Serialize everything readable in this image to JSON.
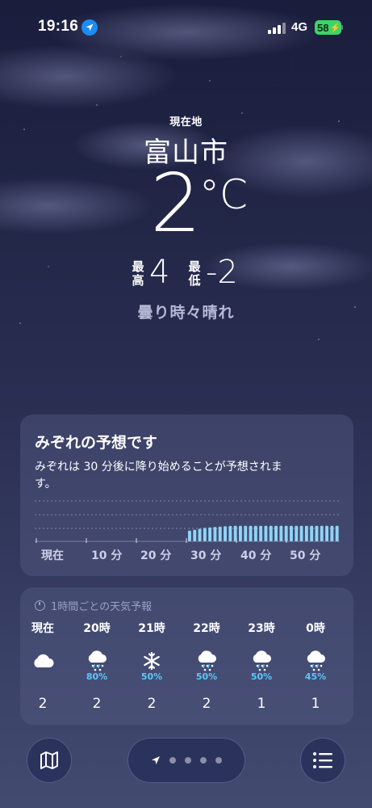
{
  "status_bar": {
    "time": "19:16",
    "network": "4G",
    "battery": "58"
  },
  "header": {
    "location_label": "現在地",
    "city": "富山市",
    "temperature": "2",
    "unit": "°C",
    "high_label": "最高",
    "high": "4",
    "low_label": "最低",
    "low": "-2",
    "condition": "曇り時々晴れ"
  },
  "precip_card": {
    "title": "みぞれの予想です",
    "description": "みぞれは 30 分後に降り始めることが予想されます。",
    "ticks": [
      "現在",
      "10 分",
      "20 分",
      "30 分",
      "40 分",
      "50 分"
    ],
    "intensity": [
      0,
      0,
      0,
      0,
      0,
      0,
      0,
      0,
      0,
      0,
      0,
      0,
      0,
      0,
      0,
      0,
      0,
      0,
      0,
      0,
      0,
      0,
      0,
      0,
      0,
      0,
      0,
      0,
      0,
      0,
      0.55,
      0.6,
      0.65,
      0.7,
      0.72,
      0.74,
      0.76,
      0.78,
      0.79,
      0.8,
      0.8,
      0.8,
      0.8,
      0.8,
      0.8,
      0.8,
      0.8,
      0.8,
      0.8,
      0.8,
      0.8,
      0.8,
      0.8,
      0.8,
      0.8,
      0.8,
      0.8,
      0.8,
      0.8,
      0.8
    ]
  },
  "hourly_card": {
    "header": "1時間ごとの天気予報",
    "hours": [
      {
        "label": "現在",
        "icon": "cloud-icon",
        "pct": "",
        "temp": "2"
      },
      {
        "label": "20時",
        "icon": "sleet-icon",
        "pct": "80%",
        "temp": "2"
      },
      {
        "label": "21時",
        "icon": "snowflake-icon",
        "pct": "50%",
        "temp": "2"
      },
      {
        "label": "22時",
        "icon": "sleet-icon",
        "pct": "50%",
        "temp": "2"
      },
      {
        "label": "23時",
        "icon": "sleet-icon",
        "pct": "50%",
        "temp": "1"
      },
      {
        "label": "0時",
        "icon": "sleet-icon",
        "pct": "45%",
        "temp": "1"
      }
    ]
  },
  "colors": {
    "accent_blue": "#5ac8fa",
    "battery_green": "#3dd46a",
    "location_blue": "#1b8cf2"
  }
}
